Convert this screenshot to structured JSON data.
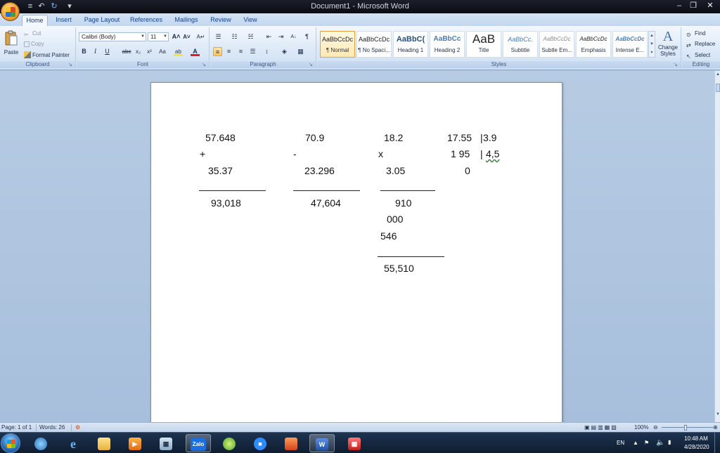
{
  "window": {
    "title": "Document1 - Microsoft Word",
    "qat": {
      "save": "≡",
      "undo": "↶",
      "redo": "↻",
      "customize": "▾"
    },
    "controls": {
      "minimize": "–",
      "restore": "❐",
      "close": "✕"
    }
  },
  "tabs": [
    "Home",
    "Insert",
    "Page Layout",
    "References",
    "Mailings",
    "Review",
    "View"
  ],
  "ribbon": {
    "clipboard": {
      "label": "Clipboard",
      "paste": "Paste",
      "cut": "Cut",
      "copy": "Copy",
      "format_painter": "Format Painter"
    },
    "font": {
      "label": "Font",
      "font_name": "Calibri (Body)",
      "font_size": "11",
      "grow": "A˄",
      "shrink": "A˅",
      "clear": "A↵",
      "bold": "B",
      "italic": "I",
      "underline": "U",
      "strike": "abc",
      "subscript": "x₂",
      "superscript": "x²",
      "change_case": "Aa",
      "highlight": "ab",
      "font_color": "A"
    },
    "paragraph": {
      "label": "Paragraph",
      "pilcrow": "¶",
      "sort": "A↓"
    },
    "styles": {
      "label": "Styles",
      "items": [
        {
          "sample": "AaBbCcDc",
          "name": "¶ Normal"
        },
        {
          "sample": "AaBbCcDc",
          "name": "¶ No Spaci..."
        },
        {
          "sample": "AaBbC(",
          "name": "Heading 1"
        },
        {
          "sample": "AaBbCc",
          "name": "Heading 2"
        },
        {
          "sample": "AaB",
          "name": "Title"
        },
        {
          "sample": "AaBbCc.",
          "name": "Subtitle"
        },
        {
          "sample": "AaBbCcDc",
          "name": "Subtle Em..."
        },
        {
          "sample": "AaBbCcDc",
          "name": "Emphasis"
        },
        {
          "sample": "AaBbCcDc",
          "name": "Intense E..."
        }
      ],
      "change_styles": "Change Styles"
    },
    "editing": {
      "label": "Editing",
      "find": "Find",
      "replace": "Replace",
      "select": "Select"
    }
  },
  "document": {
    "addition": {
      "a": "57.648",
      "op": "+",
      "b": "35.37",
      "result": "93,018"
    },
    "subtraction": {
      "a": "70.9",
      "op": "-",
      "b": "23.296",
      "result": "47,604"
    },
    "multiplication": {
      "a": "18.2",
      "op": "x",
      "b": "3.05",
      "p1": "910",
      "p2": "000",
      "p3": "546",
      "result": "55,510"
    },
    "division": {
      "dividend": "17.55",
      "divisor": "3.9",
      "rem1": "1 95",
      "quotient": "4,5",
      "rem2": "0",
      "bar": "|"
    }
  },
  "status": {
    "page": "Page: 1 of 1",
    "words": "Words: 26",
    "zoom": "100%"
  },
  "tray": {
    "lang": "EN",
    "time": "10:48 AM",
    "date": "4/28/2020"
  },
  "taskbar": {
    "zalo": "Zalo",
    "word": "W"
  }
}
